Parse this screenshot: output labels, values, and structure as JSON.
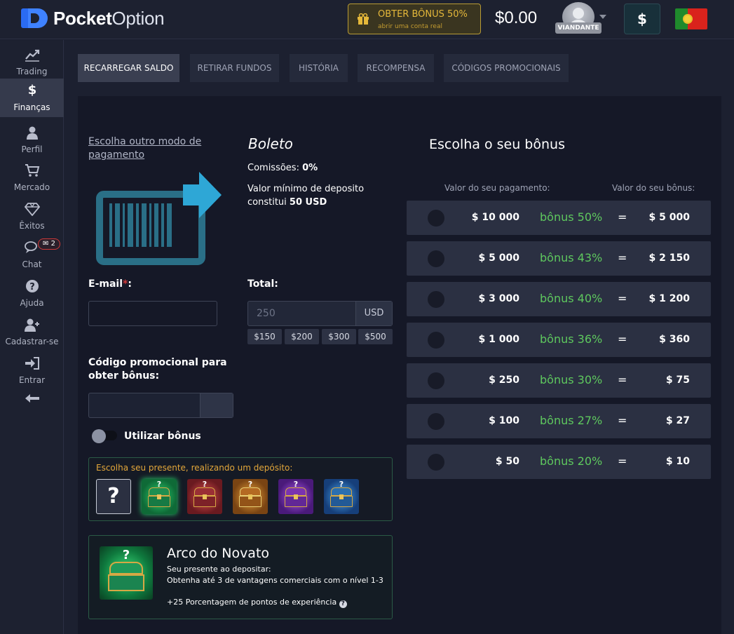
{
  "header": {
    "logo_bold": "Pocket",
    "logo_light": "Option",
    "bonus_title": "OBTER BÔNUS 50%",
    "bonus_sub": "abrir uma conta real",
    "balance": "$0.00",
    "rank": "VIANDANTE",
    "dollar_label": "$"
  },
  "sidebar": {
    "items": [
      {
        "label": "Trading",
        "icon": "chart-line-icon"
      },
      {
        "label": "Finanças",
        "icon": "dollar-icon",
        "active": true
      },
      {
        "label": "Perfil",
        "icon": "user-icon"
      },
      {
        "label": "Mercado",
        "icon": "cart-icon"
      },
      {
        "label": "Êxitos",
        "icon": "diamond-icon"
      },
      {
        "label": "Chat",
        "icon": "chat-icon",
        "badge": "2"
      },
      {
        "label": "Ajuda",
        "icon": "help-icon"
      },
      {
        "label": "Cadastrar-se",
        "icon": "user-plus-icon"
      },
      {
        "label": "Entrar",
        "icon": "sign-in-icon"
      }
    ]
  },
  "tabs": [
    {
      "label": "RECARREGAR SALDO",
      "active": true
    },
    {
      "label": "RETIRAR FUNDOS"
    },
    {
      "label": "HISTÓRIA"
    },
    {
      "label": "RECOMPENSA"
    },
    {
      "label": "CÓDIGOS PROMOCIONAIS"
    }
  ],
  "payment": {
    "other_method_link": "Escolha outro modo de pagamento",
    "name": "Boleto",
    "fee_label": "Comissões:",
    "fee_value": "0%",
    "min_label": "Valor mínimo de deposito constitui",
    "min_value": "50 USD"
  },
  "form": {
    "email_label": "E-mail",
    "email_required": "*",
    "email_suffix": ":",
    "total_label": "Total:",
    "total_placeholder": "250",
    "currency": "USD",
    "quick_amounts": [
      "$150",
      "$200",
      "$300",
      "$500"
    ],
    "promo_label": "Código promocional para obter bônus:",
    "use_bonus_label": "Utilizar bônus"
  },
  "gifts": {
    "hint": "Escolha seu presente, realizando um depósito:",
    "question_mark": "?"
  },
  "reward": {
    "title": "Arco do Novato",
    "subtitle": "Seu presente ao depositar:",
    "description": "Obtenha até 3 de vantagens comerciais com o nível 1-3",
    "xp": "+25 Porcentagem de pontos de experiência",
    "info": "?"
  },
  "bonus_table": {
    "title": "Escolha o seu bônus",
    "col_payment": "Valor do seu pagamento:",
    "col_bonus": "Valor do seu bônus:",
    "equals": "=",
    "rows": [
      {
        "payment": "$ 10 000",
        "bonus_pct": "bônus 50%",
        "bonus_value": "$ 5 000"
      },
      {
        "payment": "$ 5 000",
        "bonus_pct": "bônus 43%",
        "bonus_value": "$ 2 150"
      },
      {
        "payment": "$ 3 000",
        "bonus_pct": "bônus 40%",
        "bonus_value": "$ 1 200"
      },
      {
        "payment": "$ 1 000",
        "bonus_pct": "bônus 36%",
        "bonus_value": "$ 360"
      },
      {
        "payment": "$ 250",
        "bonus_pct": "bônus 30%",
        "bonus_value": "$ 75"
      },
      {
        "payment": "$ 100",
        "bonus_pct": "bônus 27%",
        "bonus_value": "$ 27"
      },
      {
        "payment": "$ 50",
        "bonus_pct": "bônus 20%",
        "bonus_value": "$ 10"
      }
    ]
  },
  "colors": {
    "accent_green": "#5ec85e",
    "bonus_gold": "#e5b83a",
    "brand_blue": "#3f82ff",
    "background": "#1c2030"
  }
}
